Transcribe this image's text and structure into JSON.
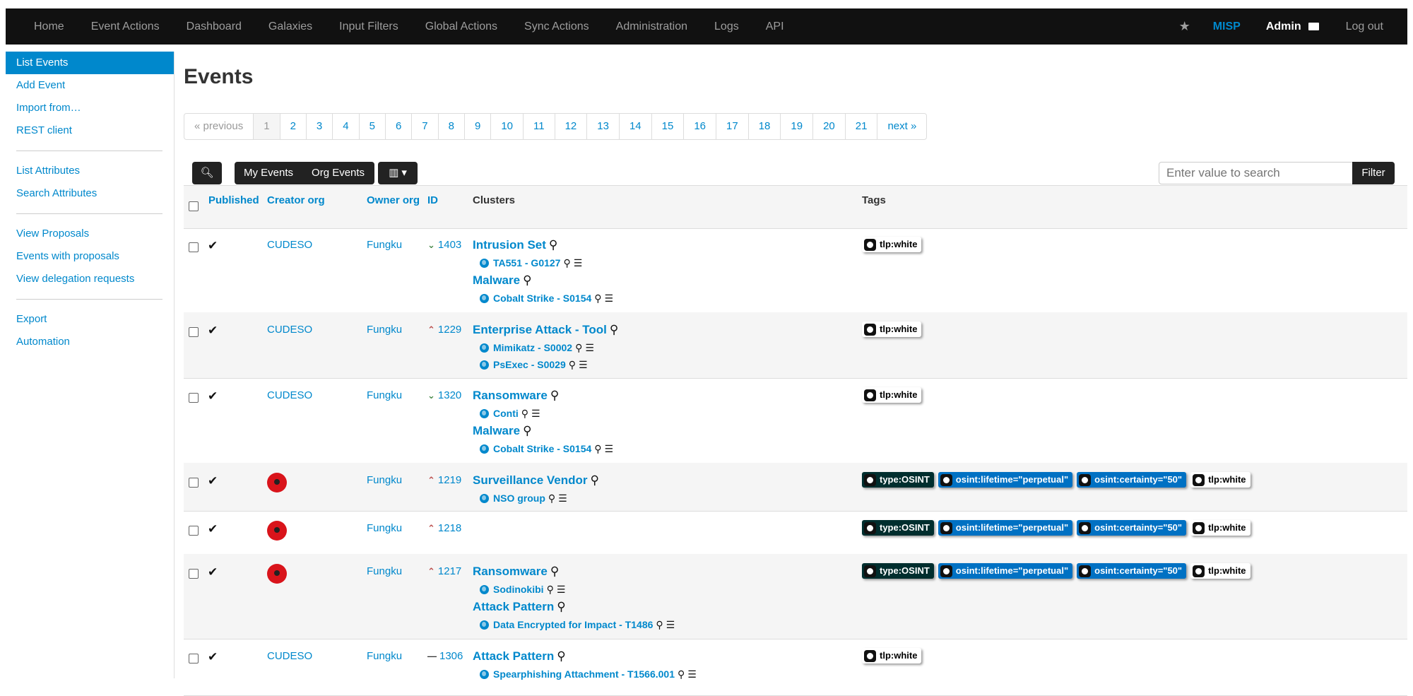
{
  "nav": {
    "left": [
      "Home",
      "Event Actions",
      "Dashboard",
      "Galaxies",
      "Input Filters",
      "Global Actions",
      "Sync Actions",
      "Administration",
      "Logs",
      "API"
    ],
    "brand": "MISP",
    "user": "Admin",
    "logout": "Log out"
  },
  "sidebar": {
    "groups": [
      [
        "List Events",
        "Add Event",
        "Import from…",
        "REST client"
      ],
      [
        "List Attributes",
        "Search Attributes"
      ],
      [
        "View Proposals",
        "Events with proposals",
        "View delegation requests"
      ],
      [
        "Export",
        "Automation"
      ]
    ],
    "active": "List Events"
  },
  "page_title": "Events",
  "pagination": {
    "previous": "« previous",
    "pages": [
      "1",
      "2",
      "3",
      "4",
      "5",
      "6",
      "7",
      "8",
      "9",
      "10",
      "11",
      "12",
      "13",
      "14",
      "15",
      "16",
      "17",
      "18",
      "19",
      "20",
      "21"
    ],
    "current": "1",
    "next": "next »"
  },
  "toolbar": {
    "my_events": "My Events",
    "org_events": "Org Events",
    "search_placeholder": "Enter value to search",
    "filter_label": "Filter"
  },
  "columns": {
    "published": "Published",
    "creator_org": "Creator org",
    "owner_org": "Owner org",
    "id": "ID",
    "clusters": "Clusters",
    "tags": "Tags"
  },
  "events": [
    {
      "creator": "CUDESO",
      "creator_logo": false,
      "owner": "Fungku",
      "id": "1403",
      "threat": "low",
      "clusters": [
        {
          "type": "Intrusion Set",
          "values": [
            "TA551 - G0127"
          ]
        },
        {
          "type": "Malware",
          "values": [
            "Cobalt Strike - S0154"
          ]
        }
      ],
      "tags": [
        {
          "label": "tlp:white",
          "style": "white"
        }
      ]
    },
    {
      "creator": "CUDESO",
      "creator_logo": false,
      "owner": "Fungku",
      "id": "1229",
      "threat": "high",
      "clusters": [
        {
          "type": "Enterprise Attack - Tool",
          "values": [
            "Mimikatz - S0002",
            "PsExec - S0029"
          ]
        }
      ],
      "tags": [
        {
          "label": "tlp:white",
          "style": "white"
        }
      ]
    },
    {
      "creator": "CUDESO",
      "creator_logo": false,
      "owner": "Fungku",
      "id": "1320",
      "threat": "low",
      "clusters": [
        {
          "type": "Ransomware",
          "values": [
            "Conti"
          ]
        },
        {
          "type": "Malware",
          "values": [
            "Cobalt Strike - S0154"
          ]
        }
      ],
      "tags": [
        {
          "label": "tlp:white",
          "style": "white"
        }
      ]
    },
    {
      "creator": "",
      "creator_logo": true,
      "owner": "Fungku",
      "id": "1219",
      "threat": "high",
      "clusters": [
        {
          "type": "Surveillance Vendor",
          "values": [
            "NSO group"
          ]
        }
      ],
      "tags": [
        {
          "label": "type:OSINT",
          "style": "dark"
        },
        {
          "label": "osint:lifetime=\"perpetual\"",
          "style": "blue"
        },
        {
          "label": "osint:certainty=\"50\"",
          "style": "blue"
        },
        {
          "label": "tlp:white",
          "style": "white"
        }
      ]
    },
    {
      "creator": "",
      "creator_logo": true,
      "owner": "Fungku",
      "id": "1218",
      "threat": "high",
      "clusters": [],
      "tags": [
        {
          "label": "type:OSINT",
          "style": "dark"
        },
        {
          "label": "osint:lifetime=\"perpetual\"",
          "style": "blue"
        },
        {
          "label": "osint:certainty=\"50\"",
          "style": "blue"
        },
        {
          "label": "tlp:white",
          "style": "white"
        }
      ]
    },
    {
      "creator": "",
      "creator_logo": true,
      "owner": "Fungku",
      "id": "1217",
      "threat": "high",
      "clusters": [
        {
          "type": "Ransomware",
          "values": [
            "Sodinokibi"
          ]
        },
        {
          "type": "Attack Pattern",
          "values": [
            "Data Encrypted for Impact - T1486"
          ]
        }
      ],
      "tags": [
        {
          "label": "type:OSINT",
          "style": "dark"
        },
        {
          "label": "osint:lifetime=\"perpetual\"",
          "style": "blue"
        },
        {
          "label": "osint:certainty=\"50\"",
          "style": "blue"
        },
        {
          "label": "tlp:white",
          "style": "white"
        }
      ]
    },
    {
      "creator": "CUDESO",
      "creator_logo": false,
      "owner": "Fungku",
      "id": "1306",
      "threat": "undefined",
      "clusters": [
        {
          "type": "Attack Pattern",
          "values": [
            "Spearphishing Attachment - T1566.001"
          ]
        }
      ],
      "tags": [
        {
          "label": "tlp:white",
          "style": "white"
        }
      ]
    }
  ]
}
